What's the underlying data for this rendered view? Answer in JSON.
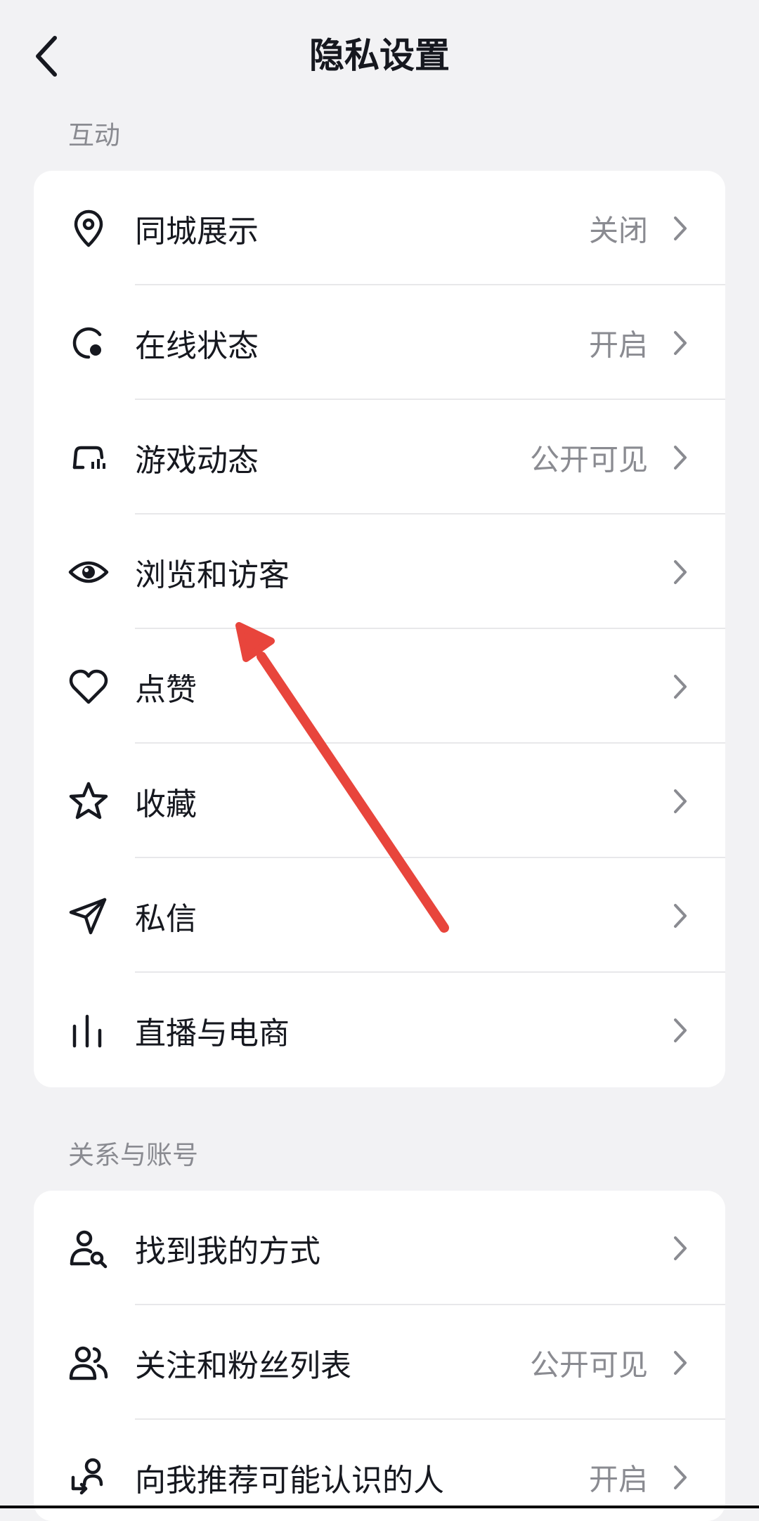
{
  "header": {
    "title": "隐私设置"
  },
  "sections": [
    {
      "label": "互动",
      "items": [
        {
          "label": "同城展示",
          "value": "关闭",
          "icon": "location-pin-icon"
        },
        {
          "label": "在线状态",
          "value": "开启",
          "icon": "online-status-icon"
        },
        {
          "label": "游戏动态",
          "value": "公开可见",
          "icon": "game-controller-icon"
        },
        {
          "label": "浏览和访客",
          "value": "",
          "icon": "eye-icon"
        },
        {
          "label": "点赞",
          "value": "",
          "icon": "heart-icon"
        },
        {
          "label": "收藏",
          "value": "",
          "icon": "star-icon"
        },
        {
          "label": "私信",
          "value": "",
          "icon": "paper-plane-icon"
        },
        {
          "label": "直播与电商",
          "value": "",
          "icon": "bars-icon"
        }
      ]
    },
    {
      "label": "关系与账号",
      "items": [
        {
          "label": "找到我的方式",
          "value": "",
          "icon": "user-search-icon"
        },
        {
          "label": "关注和粉丝列表",
          "value": "公开可见",
          "icon": "users-icon"
        },
        {
          "label": "向我推荐可能认识的人",
          "value": "开启",
          "icon": "user-recommend-icon"
        }
      ]
    }
  ],
  "colors": {
    "background": "#f2f2f4",
    "card": "#ffffff",
    "annotation_arrow": "#e8453c"
  }
}
